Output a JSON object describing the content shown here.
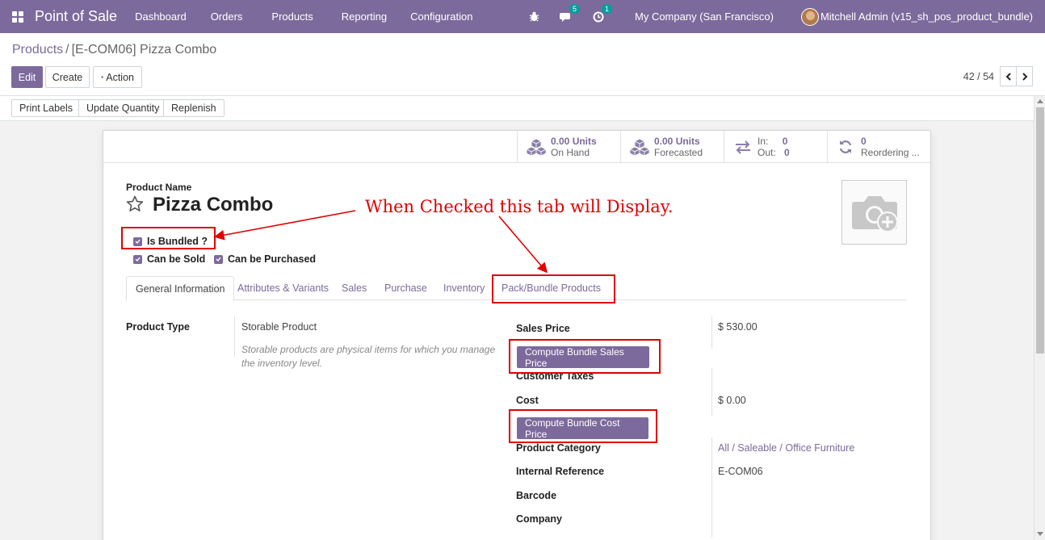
{
  "navbar": {
    "app_title": "Point of Sale",
    "menu": [
      "Dashboard",
      "Orders",
      "Products",
      "Reporting",
      "Configuration"
    ],
    "messages_badge": "5",
    "activity_badge": "1",
    "company": "My Company (San Francisco)",
    "user": "Mitchell Admin (v15_sh_pos_product_bundle)"
  },
  "control": {
    "breadcrumb_parent": "Products",
    "breadcrumb_sep": "/",
    "breadcrumb_current": "[E-COM06] Pizza Combo",
    "edit_label": "Edit",
    "create_label": "Create",
    "action_label": "Action",
    "pager": "42 / 54"
  },
  "statusbar": {
    "buttons": [
      "Print Labels",
      "Update Quantity",
      "Replenish"
    ]
  },
  "smart_buttons": [
    {
      "value": "0.00 Units",
      "label": "On Hand"
    },
    {
      "value": "0.00 Units",
      "label": "Forecasted"
    },
    {
      "in_label": "In:",
      "in_value": "0",
      "out_label": "Out:",
      "out_value": "0"
    },
    {
      "value": "0",
      "label": "Reordering ..."
    }
  ],
  "product": {
    "name_label": "Product Name",
    "name": "Pizza Combo",
    "is_bundled": "Is Bundled ?",
    "can_be_sold": "Can be Sold",
    "can_be_purchased": "Can be Purchased"
  },
  "tabs": [
    "General Information",
    "Attributes & Variants",
    "Sales",
    "Purchase",
    "Inventory",
    "Pack/Bundle Products"
  ],
  "general": {
    "product_type_label": "Product Type",
    "product_type_value": "Storable Product",
    "product_type_help": "Storable products are physical items for which you manage the inventory level.",
    "sales_price_label": "Sales Price",
    "sales_price_value": "$ 530.00",
    "compute_sales_btn": "Compute Bundle Sales Price",
    "customer_taxes_label": "Customer Taxes",
    "cost_label": "Cost",
    "cost_value": "$ 0.00",
    "compute_cost_btn": "Compute Bundle Cost Price",
    "category_label": "Product Category",
    "category_value": "All / Saleable / Office Furniture",
    "internal_ref_label": "Internal Reference",
    "internal_ref_value": "E-COM06",
    "barcode_label": "Barcode",
    "company_label": "Company"
  },
  "annotation": {
    "text": "When Checked this tab will Display."
  },
  "colors": {
    "brand": "#7c6a9c",
    "annotation_red": "#e00000",
    "badge_teal": "#00a09d"
  }
}
